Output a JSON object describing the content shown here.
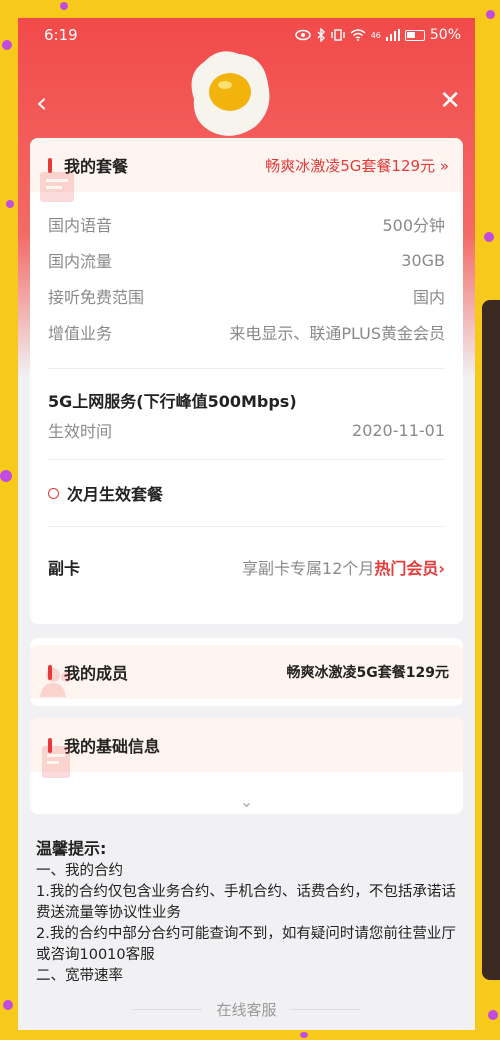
{
  "status_bar": {
    "time": "6:19",
    "icons": [
      "eye-icon",
      "bluetooth-icon",
      "vibrate-icon",
      "wifi-icon",
      "signal-icon",
      "battery-icon"
    ],
    "signal_text": "46",
    "battery_text": "50%"
  },
  "nav": {
    "back_glyph": "‹",
    "close_glyph": "✕"
  },
  "plan_card": {
    "title": "我的套餐",
    "plan_link": "畅爽冰激凌5G套餐129元 »",
    "rows": [
      {
        "label": "国内语音",
        "value": "500分钟"
      },
      {
        "label": "国内流量",
        "value": "30GB"
      },
      {
        "label": "接听免费范围",
        "value": "国内"
      },
      {
        "label": "增值业务",
        "value": "来电显示、联通PLUS黄金会员"
      }
    ],
    "service_title": "5G上网服务(下行峰值500Mbps)",
    "effective_label": "生效时间",
    "effective_value": "2020-11-01",
    "next_month": "次月生效套餐",
    "vice_card_label": "副卡",
    "vice_card_text": "享副卡专属12个月",
    "vice_card_hot": "热门会员",
    "vice_arrow": "›"
  },
  "members_card": {
    "title": "我的成员",
    "plan": "畅爽冰激凌5G套餐129元"
  },
  "basic_card": {
    "title": "我的基础信息",
    "expand_glyph": "⌄"
  },
  "tips": {
    "title": "温馨提示:",
    "lines": [
      "一、我的合约",
      "1.我的合约仅包含业务合约、手机合约、话费合约，不包括承诺话费送流量等协议性业务",
      "2.我的合约中部分合约可能查询不到，如有疑问时请您前往营业厅或咨询10010客服",
      "二、宽带速率"
    ]
  },
  "online_service": "在线客服",
  "colors": {
    "accent": "#e43a3a",
    "frame": "#f7c91a",
    "dots": "#c24be0"
  }
}
